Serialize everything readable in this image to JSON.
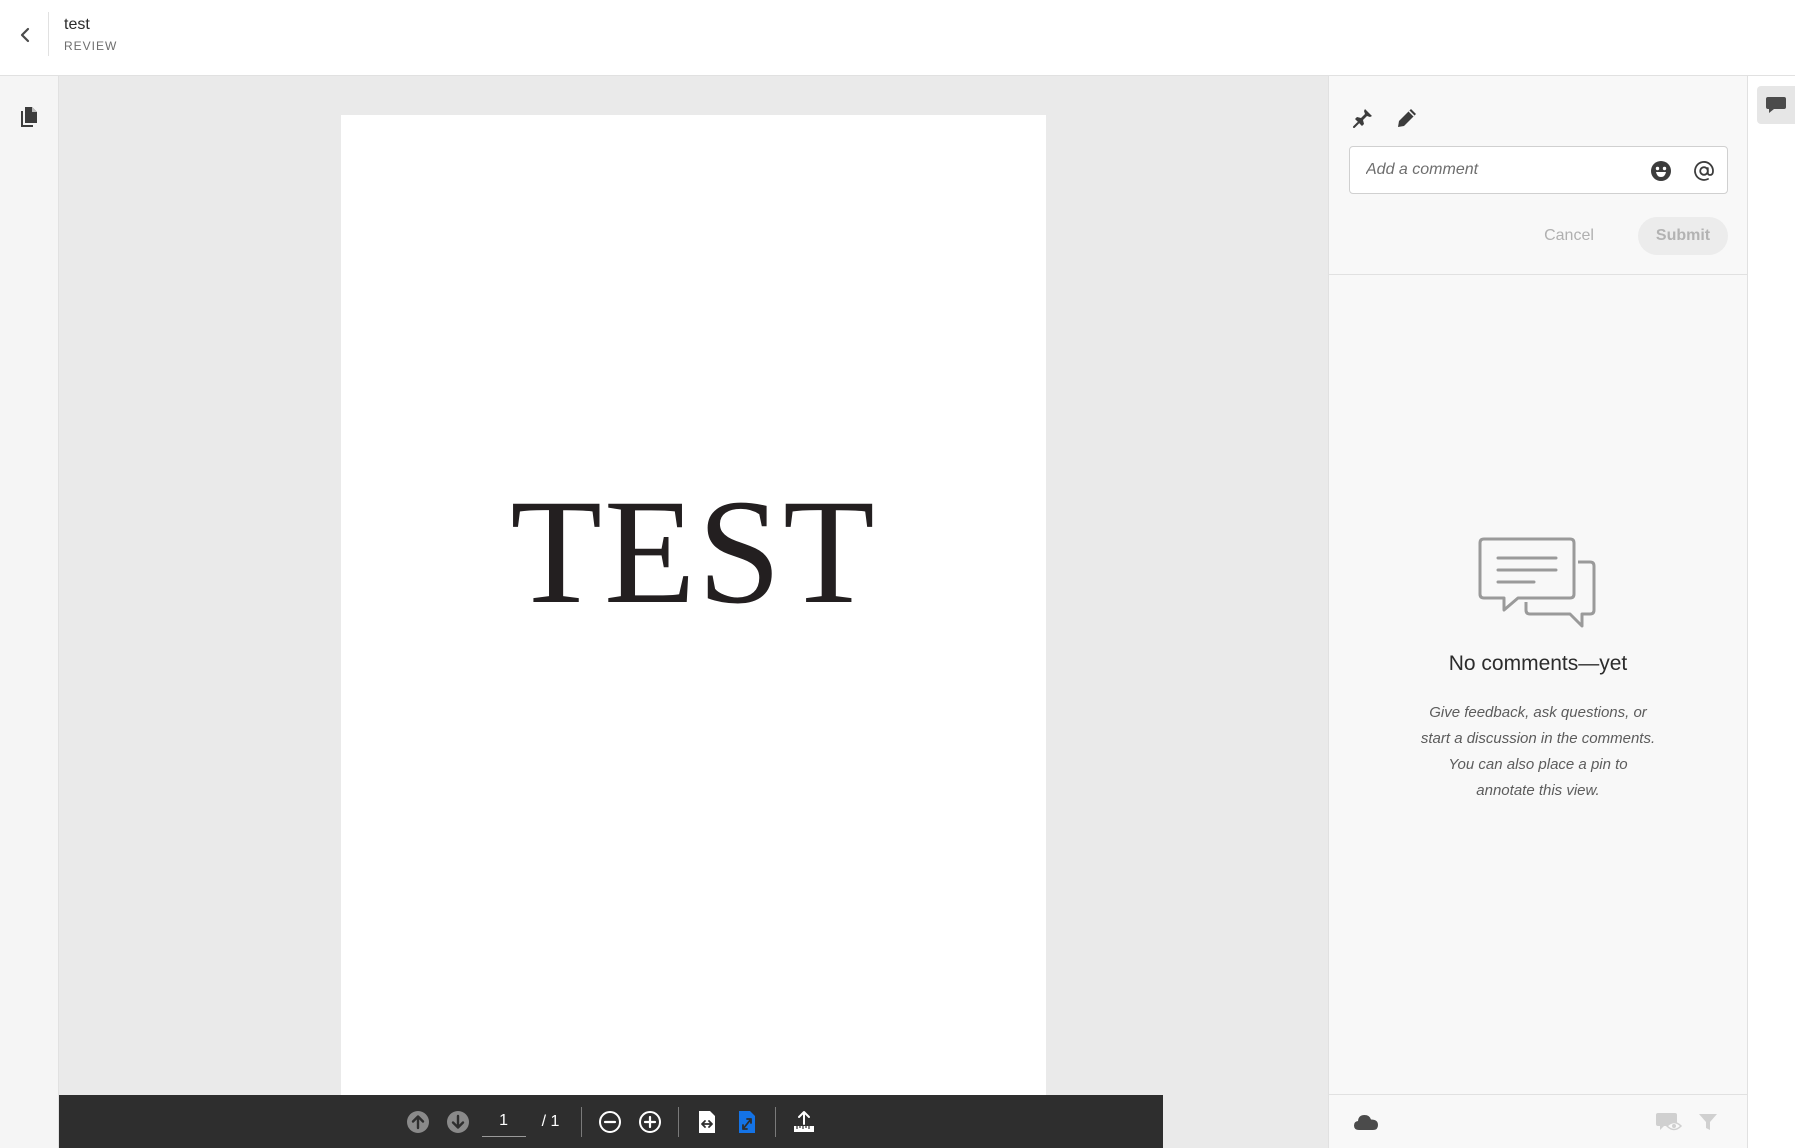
{
  "header": {
    "title": "test",
    "subtitle": "REVIEW",
    "back_icon": "chevron-left-icon"
  },
  "left_rail": {
    "items": [
      {
        "icon": "document-pages-icon"
      }
    ]
  },
  "document": {
    "page_text": "TEST"
  },
  "toolbar": {
    "current_page": "1",
    "total_pages": "/ 1",
    "icons": [
      "arrow-up-circle-icon",
      "arrow-down-circle-icon",
      "zoom-out-icon",
      "zoom-in-icon",
      "fit-width-icon",
      "fit-page-icon",
      "export-icon"
    ],
    "active_color": "#1473e6"
  },
  "comments": {
    "tools": [
      "pin-icon",
      "pencil-icon"
    ],
    "placeholder": "Add a comment",
    "emoji_icon": "emoji-icon",
    "mention_icon": "at-mention-icon",
    "cancel_label": "Cancel",
    "submit_label": "Submit",
    "empty_title": "No comments—yet",
    "empty_description": "Give feedback, ask questions, or start a discussion in the comments. You can also place a pin to annotate this view.",
    "footer_icons": [
      "cloud-icon",
      "hide-comments-icon",
      "filter-icon"
    ]
  },
  "right_rail": {
    "items": [
      {
        "icon": "comments-icon",
        "active": true
      }
    ]
  }
}
